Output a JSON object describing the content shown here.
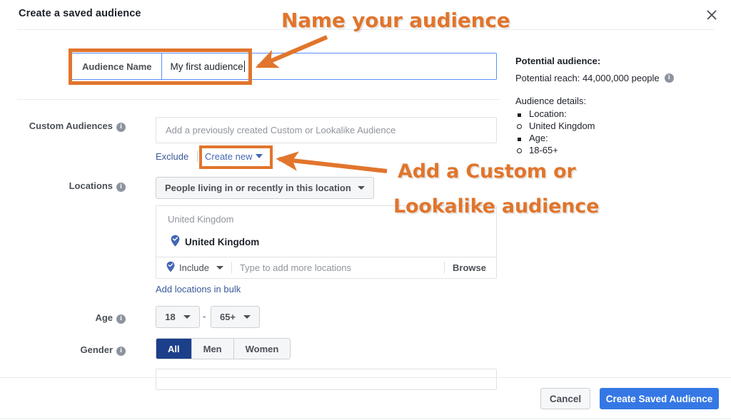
{
  "dialog": {
    "title": "Create a saved audience",
    "close_icon": "close-icon"
  },
  "form": {
    "name_row": {
      "prefix_label": "Audience Name",
      "value": "My first audience"
    },
    "custom_audiences": {
      "label": "Custom Audiences",
      "placeholder": "Add a previously created Custom or Lookalike Audience",
      "exclude_label": "Exclude",
      "create_new_label": "Create new"
    },
    "locations": {
      "label": "Locations",
      "scope_value": "People living in or recently in this location",
      "group_title": "United Kingdom",
      "selected_location": "United Kingdom",
      "include_label": "Include",
      "type_placeholder": "Type to add more locations",
      "browse_label": "Browse",
      "bulk_link": "Add locations in bulk"
    },
    "age": {
      "label": "Age",
      "min": "18",
      "max": "65+",
      "separator": "-"
    },
    "gender": {
      "label": "Gender",
      "options": [
        "All",
        "Men",
        "Women"
      ],
      "selected": "All"
    }
  },
  "side_panel": {
    "heading": "Potential audience:",
    "reach": "Potential reach: 44,000,000 people",
    "details_heading": "Audience details:",
    "details": [
      {
        "marker": "square",
        "text": "Location:"
      },
      {
        "marker": "circle",
        "text": "United Kingdom"
      },
      {
        "marker": "square",
        "text": "Age:"
      },
      {
        "marker": "circle",
        "text": "18-65+"
      }
    ]
  },
  "footer": {
    "cancel_label": "Cancel",
    "submit_label": "Create Saved Audience"
  },
  "annotations": {
    "name_callout": "Name your audience",
    "custom_callout_line1": "Add a Custom or",
    "custom_callout_line2": "Lookalike audience",
    "accent_color": "#e1752c"
  }
}
